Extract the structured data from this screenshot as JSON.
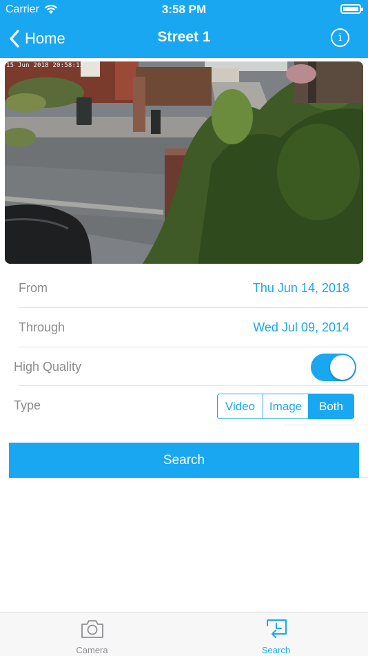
{
  "status_bar": {
    "carrier": "Carrier",
    "time": "3:58 PM"
  },
  "nav": {
    "back_label": "Home",
    "title": "Street 1",
    "info_glyph": "i"
  },
  "camera": {
    "timestamp": "15 Jun 2018 20:58:13"
  },
  "form": {
    "from_label": "From",
    "from_value": "Thu Jun 14, 2018",
    "through_label": "Through",
    "through_value": "Wed Jul 09, 2014",
    "quality_label": "High Quality",
    "quality_on": true,
    "type_label": "Type",
    "type_options": [
      "Video",
      "Image",
      "Both"
    ],
    "type_selected": "Both"
  },
  "search_label": "Search",
  "tabbar": [
    {
      "label": "Camera",
      "icon": "camera-icon",
      "active": false
    },
    {
      "label": "Search",
      "icon": "search-return-icon",
      "active": true
    }
  ],
  "colors": {
    "accent": "#1aa7f1",
    "label_gray": "#8b8b8b",
    "tab_inactive": "#8e8e93"
  }
}
